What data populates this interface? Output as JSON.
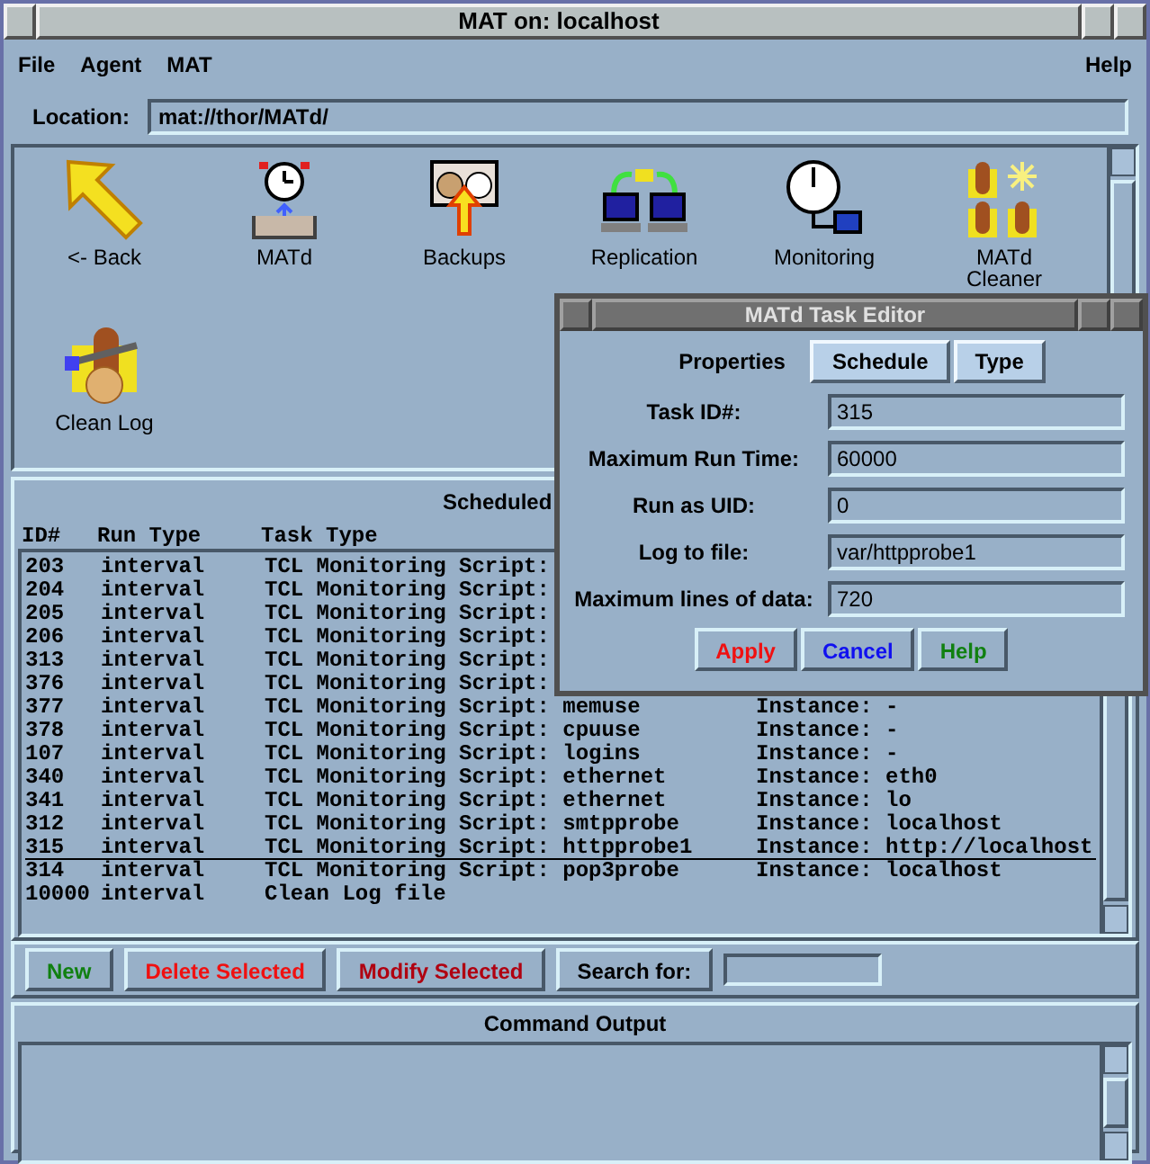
{
  "window": {
    "title": "MAT on: localhost"
  },
  "menu": [
    "File",
    "Agent",
    "MAT"
  ],
  "help_menu": "Help",
  "location": {
    "label": "Location:",
    "value": "mat://thor/MATd/"
  },
  "icons": [
    {
      "label": "<- Back",
      "kind": "back"
    },
    {
      "label": "MATd",
      "kind": "timer"
    },
    {
      "label": "Backups",
      "kind": "backup"
    },
    {
      "label": "Replication",
      "kind": "replication"
    },
    {
      "label": "Monitoring",
      "kind": "gauge"
    },
    {
      "label": "MATd Cleaner",
      "kind": "logs"
    },
    {
      "label": "Clean Log",
      "kind": "cleanlog"
    }
  ],
  "tasks": {
    "title": "Scheduled",
    "columns": [
      "ID#",
      "Run Type",
      "Task Type"
    ],
    "rows": [
      {
        "id": "203",
        "run_type": "interval",
        "task_type": "TCL Monitoring Script:",
        "selected": false
      },
      {
        "id": "204",
        "run_type": "interval",
        "task_type": "TCL Monitoring Script:",
        "selected": false
      },
      {
        "id": "205",
        "run_type": "interval",
        "task_type": "TCL Monitoring Script:",
        "selected": false
      },
      {
        "id": "206",
        "run_type": "interval",
        "task_type": "TCL Monitoring Script:",
        "selected": false
      },
      {
        "id": "313",
        "run_type": "interval",
        "task_type": "TCL Monitoring Script:",
        "selected": false
      },
      {
        "id": "376",
        "run_type": "interval",
        "task_type": "TCL Monitoring Script:",
        "selected": false
      },
      {
        "id": "377",
        "run_type": "interval",
        "task_type": "TCL Monitoring Script: memuse",
        "instance": "Instance: -",
        "selected": false
      },
      {
        "id": "378",
        "run_type": "interval",
        "task_type": "TCL Monitoring Script: cpuuse",
        "instance": "Instance: -",
        "selected": false
      },
      {
        "id": "107",
        "run_type": "interval",
        "task_type": "TCL Monitoring Script: logins",
        "instance": "Instance: -",
        "selected": false
      },
      {
        "id": "340",
        "run_type": "interval",
        "task_type": "TCL Monitoring Script: ethernet",
        "instance": "Instance: eth0",
        "selected": false
      },
      {
        "id": "341",
        "run_type": "interval",
        "task_type": "TCL Monitoring Script: ethernet",
        "instance": "Instance: lo",
        "selected": false
      },
      {
        "id": "312",
        "run_type": "interval",
        "task_type": "TCL Monitoring Script: smtpprobe",
        "instance": "Instance: localhost",
        "selected": false
      },
      {
        "id": "315",
        "run_type": "interval",
        "task_type": "TCL Monitoring Script: httpprobe1",
        "instance": "Instance: http://localhost",
        "selected": true
      },
      {
        "id": "314",
        "run_type": "interval",
        "task_type": "TCL Monitoring Script: pop3probe",
        "instance": "Instance: localhost",
        "selected": false
      },
      {
        "id": "10000",
        "run_type": "interval",
        "task_type": "Clean Log file",
        "selected": false
      }
    ]
  },
  "actions": [
    {
      "label": "New",
      "color": "#108010"
    },
    {
      "label": "Delete Selected",
      "color": "#f01010"
    },
    {
      "label": "Modify Selected",
      "color": "#b00010"
    }
  ],
  "search": {
    "label": "Search for:"
  },
  "output": {
    "title": "Command Output"
  },
  "dialog": {
    "title": "MATd Task Editor",
    "tabs": [
      {
        "label": "Properties",
        "selected": true
      },
      {
        "label": "Schedule",
        "selected": false
      },
      {
        "label": "Type",
        "selected": false
      }
    ],
    "fields": [
      {
        "label": "Task ID#:",
        "value": "315"
      },
      {
        "label": "Maximum Run Time:",
        "value": "60000"
      },
      {
        "label": "Run as UID:",
        "value": "0"
      },
      {
        "label": "Log to file:",
        "value": "var/httpprobe1"
      },
      {
        "label": "Maximum lines of data:",
        "value": "720"
      }
    ],
    "buttons": [
      {
        "label": "Apply",
        "color": "#f01010"
      },
      {
        "label": "Cancel",
        "color": "#1010f0"
      },
      {
        "label": "Help",
        "color": "#108010"
      }
    ]
  }
}
